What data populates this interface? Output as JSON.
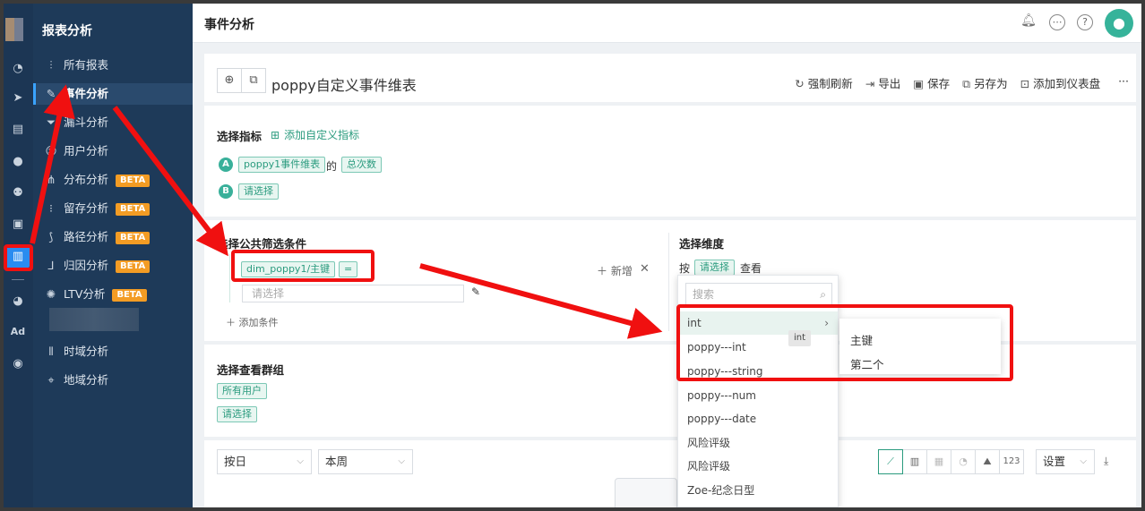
{
  "sidebar_title": "报表分析",
  "nav": [
    {
      "label": "所有报表",
      "icon": "line-chart-icon"
    },
    {
      "label": "事件分析",
      "icon": "edit-icon",
      "active": true
    },
    {
      "label": "漏斗分析",
      "icon": "funnel-icon"
    },
    {
      "label": "用户分析",
      "icon": "user-icon"
    },
    {
      "label": "分布分析",
      "icon": "distribution-icon",
      "badge": "BETA"
    },
    {
      "label": "留存分析",
      "icon": "retention-icon",
      "badge": "BETA"
    },
    {
      "label": "路径分析",
      "icon": "path-icon",
      "badge": "BETA"
    },
    {
      "label": "归因分析",
      "icon": "attribution-icon",
      "badge": "BETA"
    },
    {
      "label": "LTV分析",
      "icon": "ltv-icon",
      "badge": "BETA"
    },
    {
      "label": "时域分析",
      "icon": "bar-chart-icon"
    },
    {
      "label": "地域分析",
      "icon": "map-pin-icon"
    }
  ],
  "header": {
    "title": "事件分析"
  },
  "report": {
    "title": "poppy自定义事件维表",
    "actions": [
      "强制刷新",
      "导出",
      "保存",
      "另存为",
      "添加到仪表盘"
    ],
    "more": "···"
  },
  "metrics": {
    "title": "选择指标",
    "add_custom": "添加自定义指标",
    "a_label": "A",
    "a_event": "poppy1事件维表",
    "a_of": "的",
    "a_measure": "总次数",
    "b_label": "B",
    "b_placeholder": "请选择"
  },
  "filters": {
    "title": "选择公共筛选条件",
    "field": "dim_poppy1/主键",
    "operator": "=",
    "value_placeholder": "请选择",
    "add_new": "新增",
    "add_condition": "添加条件"
  },
  "dimension": {
    "title": "选择维度",
    "by": "按",
    "placeholder": "请选择",
    "view": "查看",
    "search_placeholder": "搜索",
    "options": [
      "int",
      "poppy---int",
      "poppy---string",
      "poppy---num",
      "poppy---date",
      "风险评级",
      "风险评级",
      "Zoe-纪念日型"
    ],
    "tooltip": "int",
    "sub_options": [
      "主键",
      "第二个"
    ]
  },
  "group": {
    "title": "选择查看群组",
    "tag": "所有用户",
    "placeholder": "请选择"
  },
  "toolbar": {
    "granularity": "按日",
    "range": "本周",
    "chart_123": "123",
    "settings": "设置"
  },
  "rail_labels": {
    "ad": "Ad"
  },
  "colors": {
    "accent": "#2a9b7e",
    "annotation": "#f01010",
    "sidebar": "#1e3a59"
  }
}
